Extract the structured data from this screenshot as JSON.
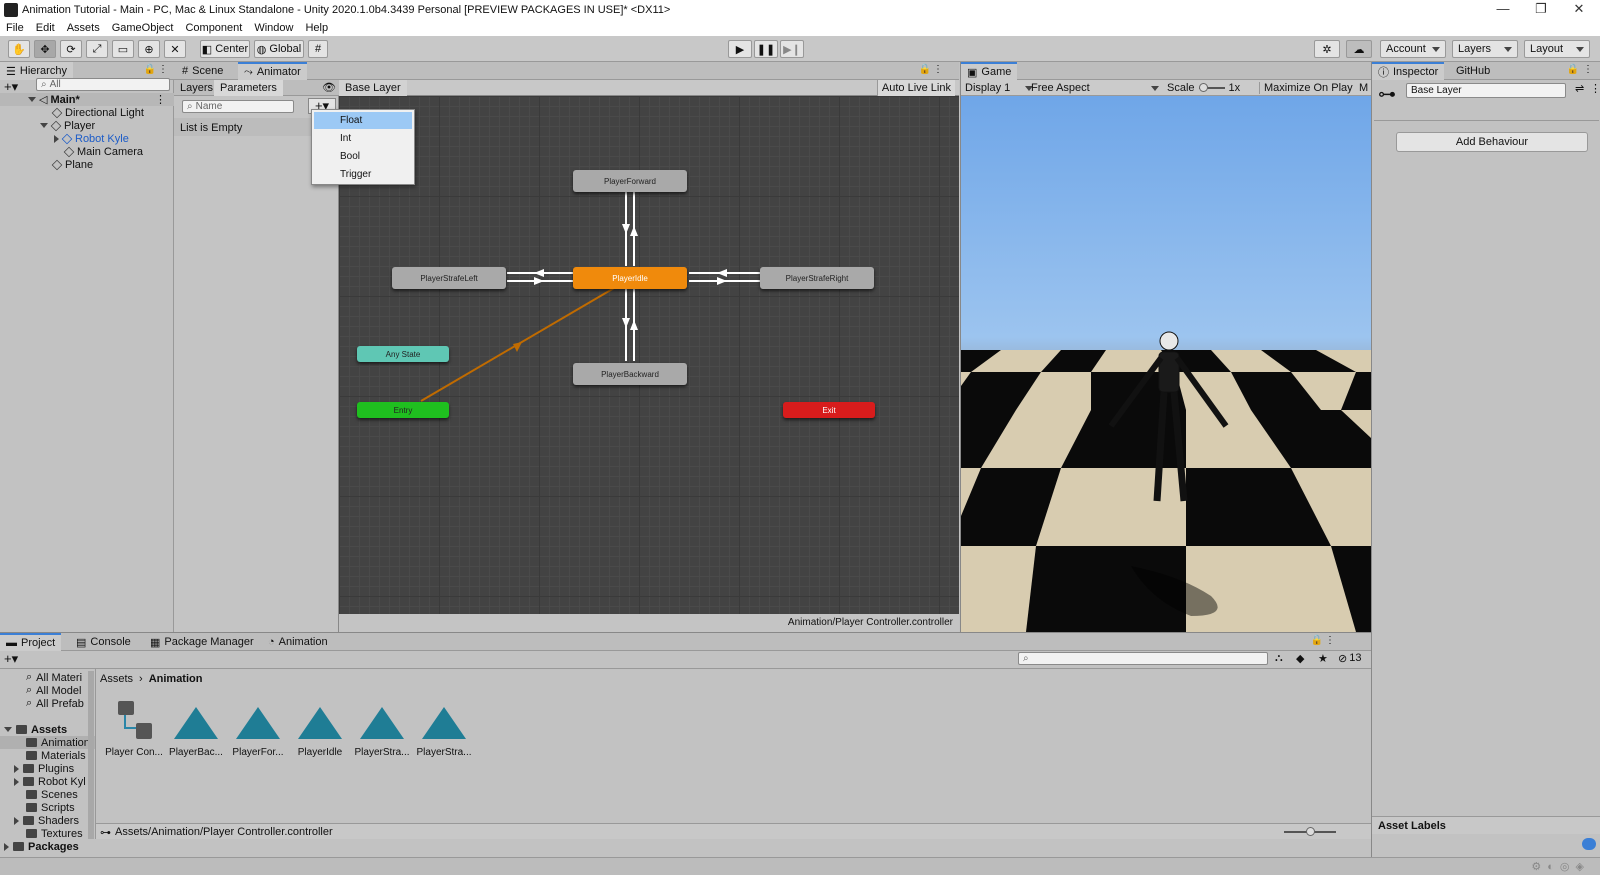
{
  "window": {
    "title": "Animation Tutorial - Main - PC, Mac & Linux Standalone - Unity 2020.1.0b4.3439 Personal [PREVIEW PACKAGES IN USE]* <DX11>",
    "minimize": "—",
    "restore": "❐",
    "close": "✕"
  },
  "menu": [
    "File",
    "Edit",
    "Assets",
    "GameObject",
    "Component",
    "Window",
    "Help"
  ],
  "toolbar": {
    "center": "Center",
    "global": "Global",
    "account": "Account",
    "layers": "Layers",
    "layout": "Layout"
  },
  "hierarchy": {
    "tab": "Hierarchy",
    "search_placeholder": "All",
    "scene": "Main*",
    "items": [
      "Directional Light",
      "Player",
      "Robot Kyle",
      "Main Camera",
      "Plane"
    ]
  },
  "animator": {
    "tabs": [
      "Scene",
      "Animator"
    ],
    "subtabs": [
      "Layers",
      "Parameters"
    ],
    "name_placeholder": "Name",
    "list_empty": "List is Empty",
    "breadcrumb": "Base Layer",
    "auto_live_link": "Auto Live Link",
    "footer_path": "Animation/Player Controller.controller",
    "states": [
      "PlayerForward",
      "PlayerStrafeLeft",
      "PlayerIdle",
      "PlayerStrafeRight",
      "PlayerBackward",
      "Any State",
      "Entry",
      "Exit"
    ],
    "dropdown": [
      "Float",
      "Int",
      "Bool",
      "Trigger"
    ]
  },
  "game": {
    "tab": "Game",
    "display": "Display 1",
    "aspect": "Free Aspect",
    "scale_label": "Scale",
    "scale_value": "1x",
    "maximize": "Maximize On Play",
    "more": "M"
  },
  "inspector": {
    "tabs": [
      "Inspector",
      "GitHub"
    ],
    "name": "Base Layer",
    "add_behaviour": "Add Behaviour",
    "asset_labels": "Asset Labels"
  },
  "project": {
    "tabs": [
      "Project",
      "Console",
      "Package Manager",
      "Animation"
    ],
    "hidden_count": "13",
    "favorites": [
      "All Materi",
      "All Model",
      "All Prefab"
    ],
    "tree_root": "Assets",
    "tree": [
      "Animation",
      "Materials",
      "Plugins",
      "Robot Kyl",
      "Scenes",
      "Scripts",
      "Shaders",
      "Textures"
    ],
    "packages": "Packages",
    "breadcrumb_root": "Assets",
    "breadcrumb_sep": "›",
    "breadcrumb_current": "Animation",
    "assets": [
      "Player Con...",
      "PlayerBac...",
      "PlayerFor...",
      "PlayerIdle",
      "PlayerStra...",
      "PlayerStra..."
    ],
    "footer_path": "Assets/Animation/Player Controller.controller"
  },
  "colors": {
    "idle": "#f08a0c",
    "any_state": "#5fc7b4",
    "entry": "#1fbf1f",
    "exit": "#d81c1c",
    "state": "#a9a9a9",
    "accent": "#3b7fd6"
  }
}
